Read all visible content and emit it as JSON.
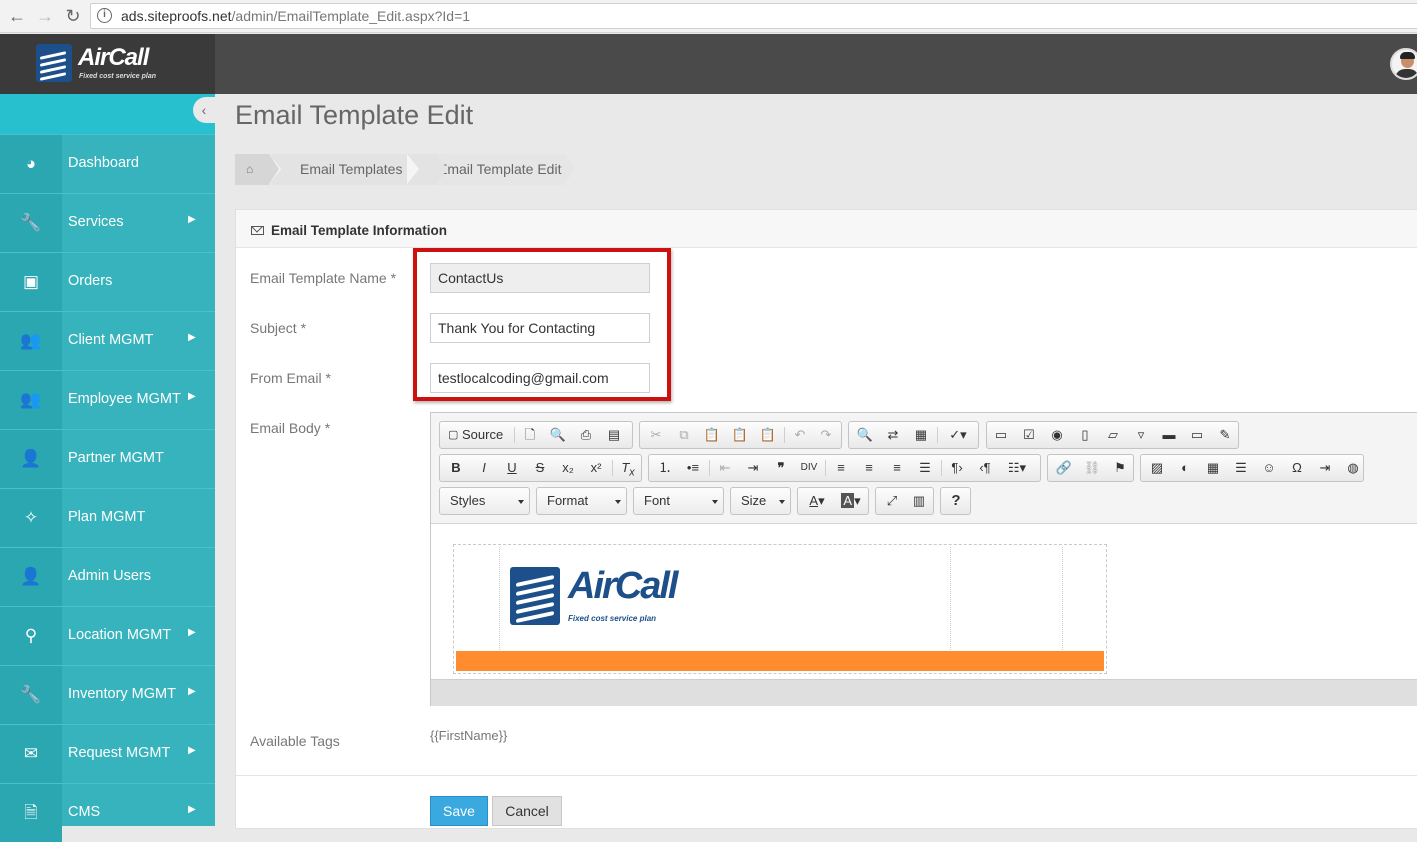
{
  "browser": {
    "host": "ads.siteproofs.net",
    "path": "/admin/EmailTemplate_Edit.aspx?Id=1"
  },
  "brand": {
    "name": "AirCall",
    "tagline": "Fixed cost service plan",
    "color": "#1d4f8a"
  },
  "sidebar": {
    "items": [
      {
        "label": "Dashboard",
        "icon": "dashboard-icon",
        "glyph": "◕",
        "submenu": false
      },
      {
        "label": "Services",
        "icon": "wrench-icon",
        "glyph": "🔧",
        "submenu": true
      },
      {
        "label": "Orders",
        "icon": "money-icon",
        "glyph": "▣",
        "submenu": false
      },
      {
        "label": "Client MGMT",
        "icon": "users-icon",
        "glyph": "👥",
        "submenu": true
      },
      {
        "label": "Employee MGMT",
        "icon": "users-icon",
        "glyph": "👥",
        "submenu": true
      },
      {
        "label": "Partner MGMT",
        "icon": "user-icon",
        "glyph": "👤",
        "submenu": false
      },
      {
        "label": "Plan MGMT",
        "icon": "magic-wand-icon",
        "glyph": "✧",
        "submenu": false
      },
      {
        "label": "Admin Users",
        "icon": "user-icon",
        "glyph": "👤",
        "submenu": false
      },
      {
        "label": "Location MGMT",
        "icon": "map-marker-icon",
        "glyph": "⚲",
        "submenu": true
      },
      {
        "label": "Inventory MGMT",
        "icon": "wrench-icon",
        "glyph": "🔧",
        "submenu": true
      },
      {
        "label": "Request MGMT",
        "icon": "envelope-icon",
        "glyph": "✉",
        "submenu": true
      },
      {
        "label": "CMS",
        "icon": "file-icon",
        "glyph": "🗎",
        "submenu": true
      }
    ]
  },
  "page": {
    "title": "Email Template Edit",
    "breadcrumb": [
      "Email Templates",
      "Email Template Edit"
    ]
  },
  "panel": {
    "title": "Email Template Information"
  },
  "form": {
    "name_label": "Email Template Name *",
    "name_value": "ContactUs",
    "subject_label": "Subject *",
    "subject_value": "Thank You for Contacting",
    "from_label": "From Email *",
    "from_value": "testlocalcoding@gmail.com",
    "body_label": "Email Body *",
    "tags_label": "Available Tags",
    "tags_value": "{{FirstName}}"
  },
  "editor": {
    "source_label": "Source",
    "combos": [
      "Styles",
      "Format",
      "Font",
      "Size"
    ],
    "email_logo_name": "AirCall",
    "email_logo_tagline": "Fixed cost service plan",
    "email_bar_color": "#ff8c2e"
  },
  "actions": {
    "save": "Save",
    "cancel": "Cancel"
  },
  "colors": {
    "sidebar": "#36b3bc",
    "highlight": "#cc1111",
    "save": "#3aa9e0"
  }
}
